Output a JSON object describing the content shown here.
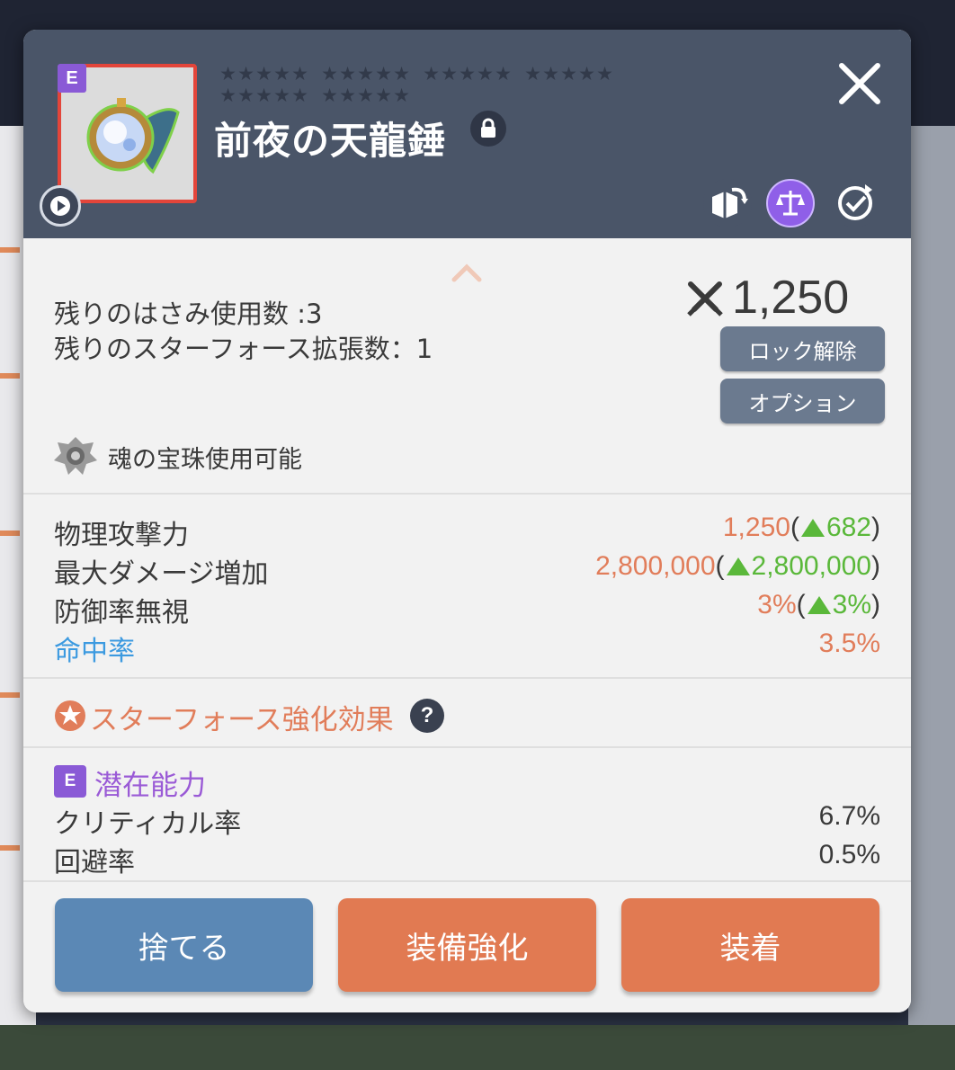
{
  "item": {
    "rank": "E",
    "name": "前夜の天龍錘",
    "star_groups": [
      [
        5,
        5,
        5,
        5
      ],
      [
        5,
        5
      ]
    ]
  },
  "header_icons": [
    "box-transfer-icon",
    "scale-icon",
    "sync-icon"
  ],
  "info": {
    "scissors_line": "残りのはさみ使用数 :3",
    "starforce_ext_line": "残りのスターフォース拡張数：1",
    "attack_power": "1,250",
    "unlock_button": "ロック解除",
    "option_button": "オプション",
    "soul_text": "魂の宝珠使用可能"
  },
  "stats": [
    {
      "label": "物理攻撃力",
      "value": "1,250",
      "delta": "682",
      "label_color": "#3a3a3a"
    },
    {
      "label": "最大ダメージ増加",
      "value": "2,800,000",
      "delta": "2,800,000",
      "label_color": "#3a3a3a"
    },
    {
      "label": "防御率無視",
      "value": "3%",
      "delta": "3%",
      "label_color": "#3a3a3a"
    },
    {
      "label": "命中率",
      "value": "3.5%",
      "delta": null,
      "label_color": "#3c9ae0"
    }
  ],
  "starforce": {
    "title": "スターフォース強化効果",
    "help": "?"
  },
  "potential": {
    "rank": "E",
    "title": "潜在能力",
    "lines": [
      {
        "label": "クリティカル率",
        "value": "6.7%"
      },
      {
        "label": "回避率",
        "value": "0.5%"
      }
    ]
  },
  "actions": {
    "discard": "捨てる",
    "enhance": "装備強化",
    "equip": "装着"
  },
  "colors": {
    "header_bg": "#4a5568",
    "value_orange": "#e17d5a",
    "up_green": "#5ab83a",
    "potential_purple": "#9a5ad6",
    "discard_blue": "#5b88b5",
    "action_orange": "#e17a52"
  }
}
